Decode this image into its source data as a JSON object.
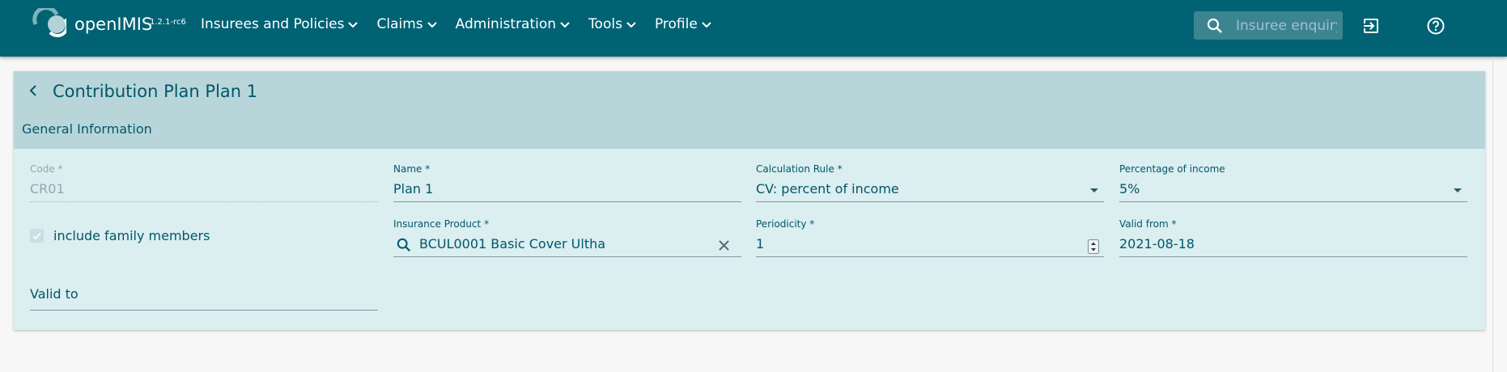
{
  "header": {
    "app_name": "openIMIS",
    "version": "1.2.1-rc6",
    "menu": [
      {
        "label": "Insurees and Policies"
      },
      {
        "label": "Claims"
      },
      {
        "label": "Administration"
      },
      {
        "label": "Tools"
      },
      {
        "label": "Profile"
      }
    ],
    "search_placeholder": "Insuree enquiry..."
  },
  "panel": {
    "title": "Contribution Plan Plan 1",
    "section": "General Information",
    "fields": {
      "code": {
        "label": "Code *",
        "value": "CR01"
      },
      "name": {
        "label": "Name *",
        "value": "Plan 1"
      },
      "calc_rule": {
        "label": "Calculation Rule *",
        "value": "CV: percent of income"
      },
      "pct_income": {
        "label": "Percentage of income",
        "value": "5%"
      },
      "include_family": {
        "label": "include family members",
        "checked": true
      },
      "product": {
        "label": "Insurance Product *",
        "value": "BCUL0001 Basic Cover Ultha"
      },
      "periodicity": {
        "label": "Periodicity *",
        "value": "1"
      },
      "valid_from": {
        "label": "Valid from *",
        "value": "2021-08-18"
      },
      "valid_to": {
        "label": "Valid to",
        "value": ""
      }
    }
  },
  "colors": {
    "header_bg": "#006273",
    "panel_head_bg": "#b8d6da",
    "panel_bg": "#dbeef0",
    "text": "#00576a"
  }
}
